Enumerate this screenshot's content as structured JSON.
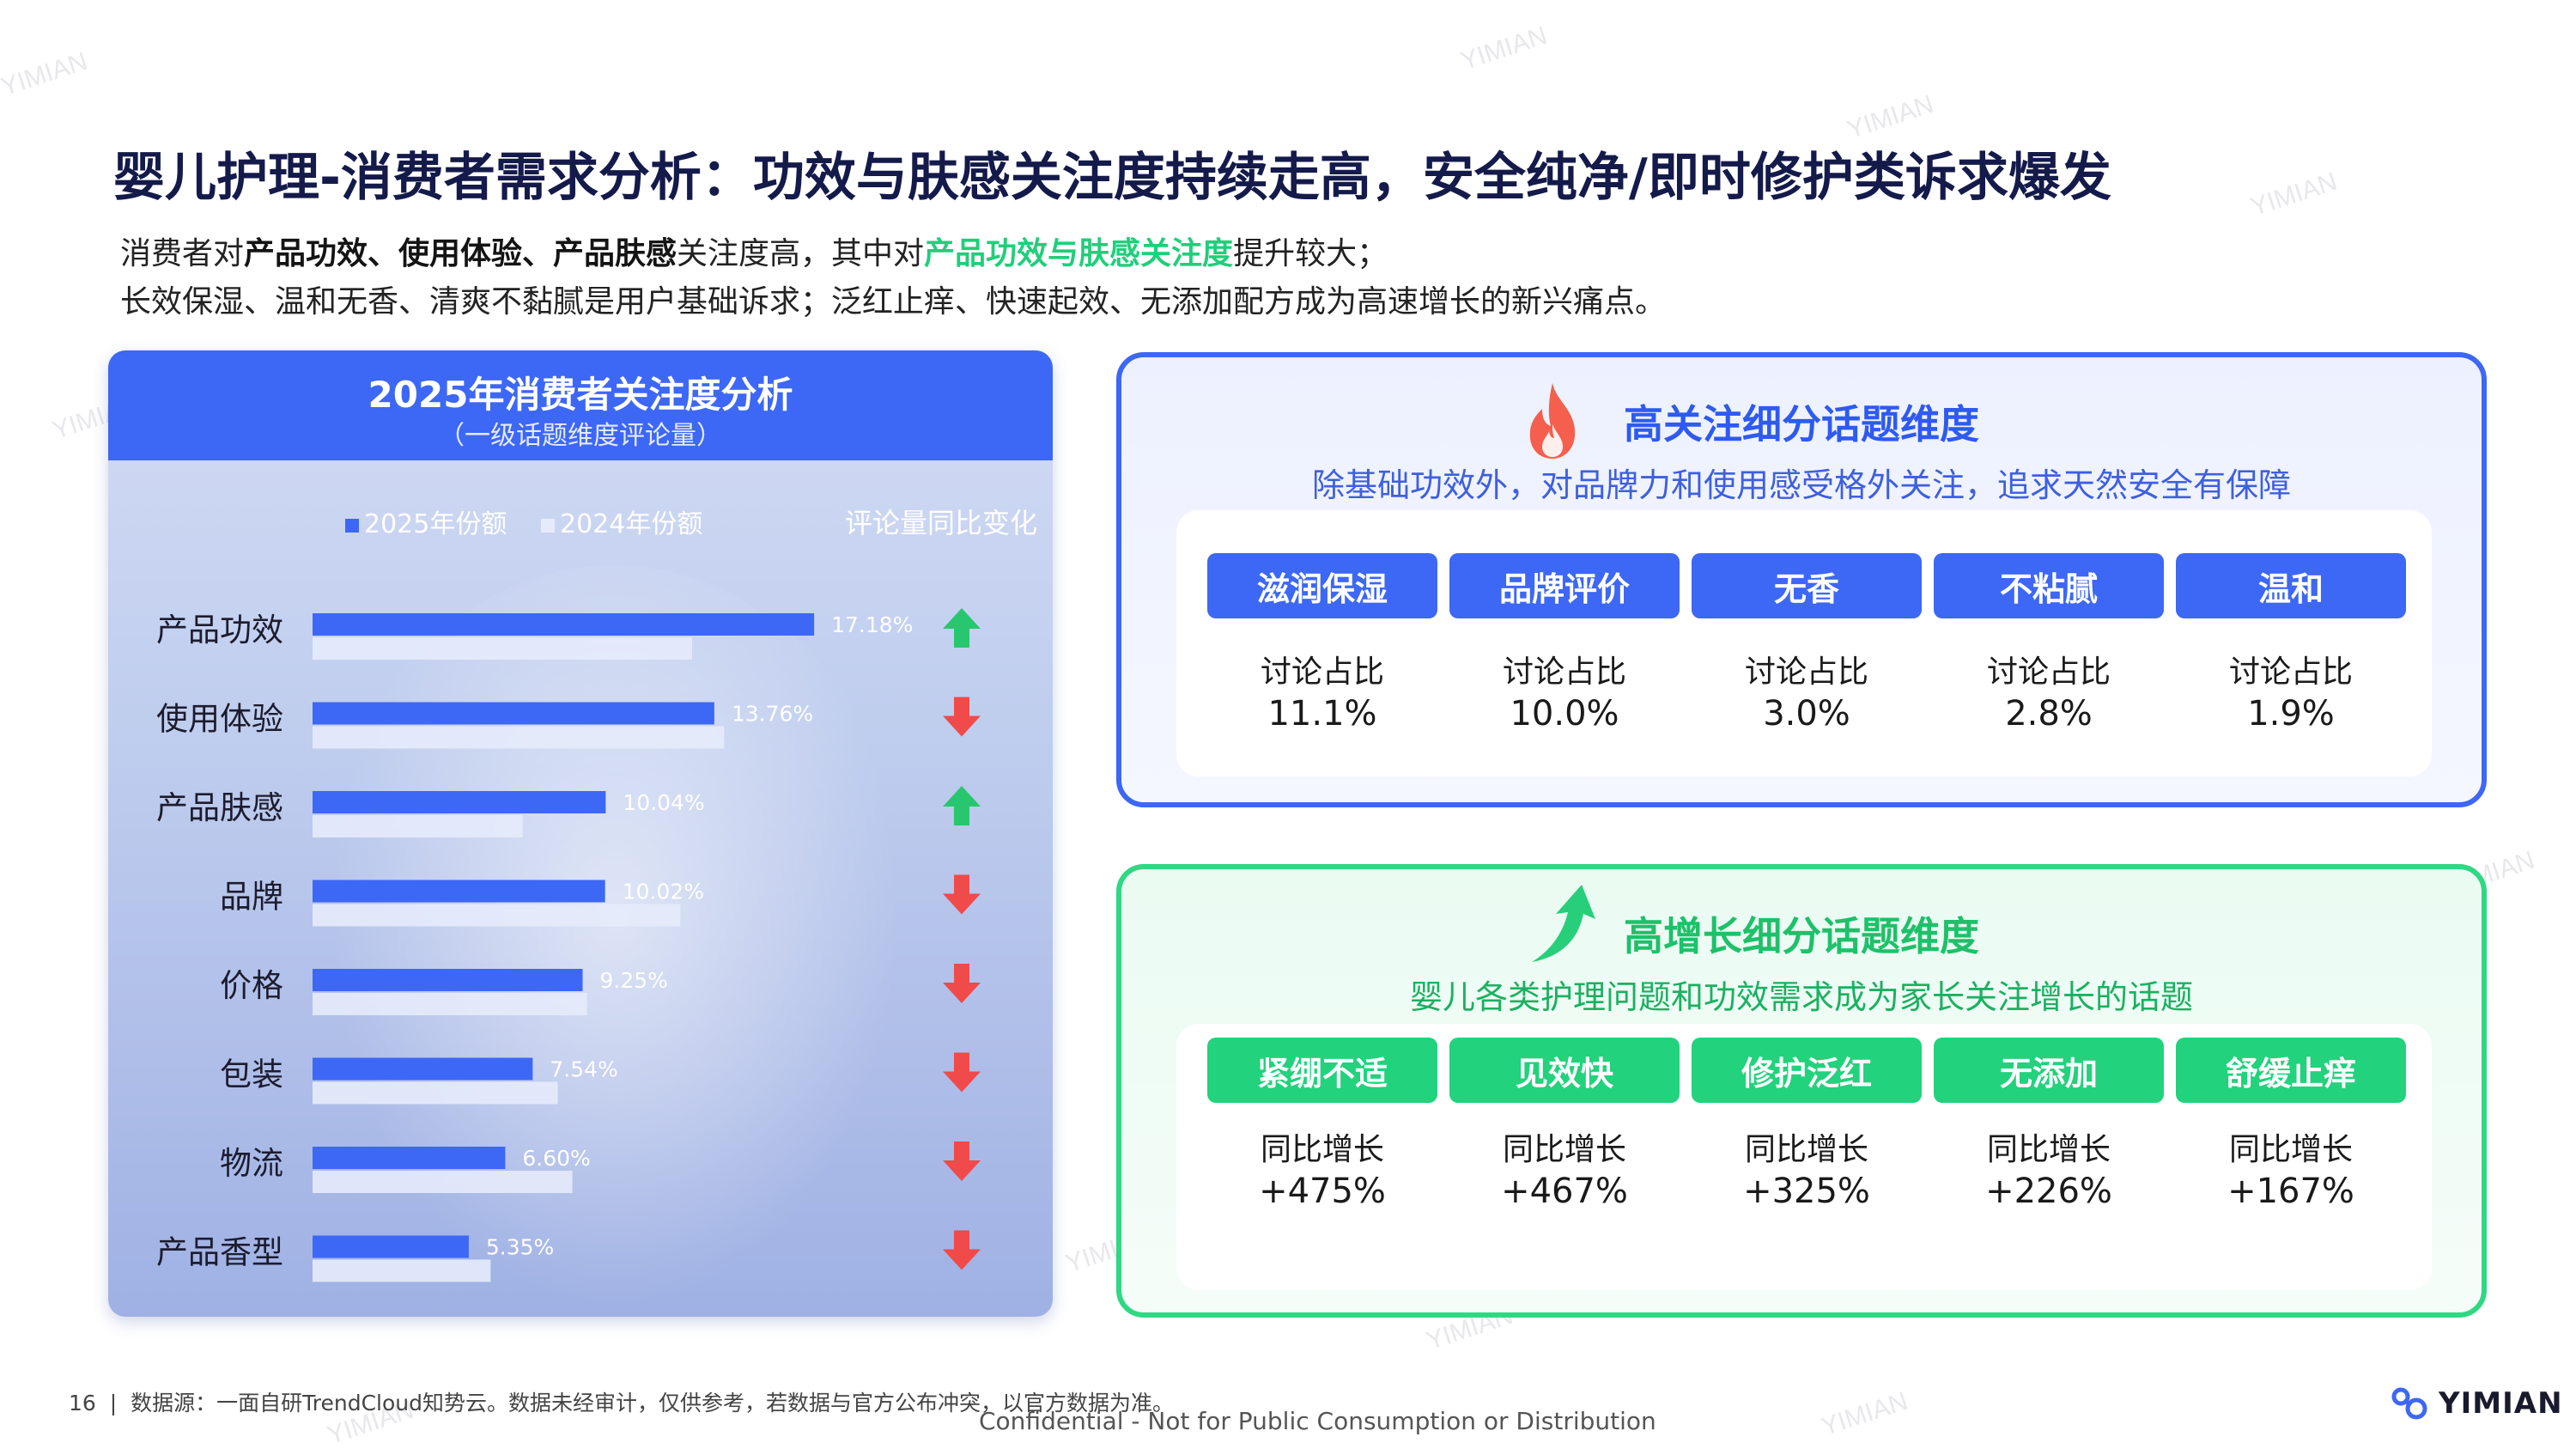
{
  "title": "婴儿护理-消费者需求分析：功效与肤感关注度持续走高，安全纯净/即时修护类诉求爆发",
  "subtitle": {
    "line1_pre": "消费者对",
    "line1_bold": "产品功效、使用体验、产品肤感",
    "line1_mid": "关注度高，其中对",
    "line1_green": "产品功效与肤感关注度",
    "line1_post": "提升较大；",
    "line2": "长效保湿、温和无香、清爽不黏腻是用户基础诉求；泛红止痒、快速起效、无添加配方成为高速增长的新兴痛点。"
  },
  "chart_panel": {
    "title": "2025年消费者关注度分析",
    "subtitle": "（一级话题维度评论量）"
  },
  "chart_data": {
    "type": "bar",
    "orientation": "horizontal",
    "title": "2025年消费者关注度分析",
    "categories": [
      "产品功效",
      "使用体验",
      "产品肤感",
      "品牌",
      "价格",
      "包装",
      "物流",
      "产品香型"
    ],
    "series": [
      {
        "name": "2025年份额",
        "values": [
          17.18,
          13.76,
          10.04,
          10.02,
          9.25,
          7.54,
          6.6,
          5.35
        ],
        "labels": [
          "17.18%",
          "13.76%",
          "10.04%",
          "10.02%",
          "9.25%",
          "7.54%",
          "6.60%",
          "5.35%"
        ]
      },
      {
        "name": "2024年份额",
        "values": [
          13.0,
          14.1,
          7.2,
          12.6,
          9.4,
          8.4,
          8.9,
          6.1
        ]
      }
    ],
    "change_header": "评论量同比变化",
    "change_direction": [
      "up",
      "down",
      "up",
      "down",
      "down",
      "down",
      "down",
      "down"
    ],
    "colors": {
      "y2025": "#3d67f5",
      "y2024": "#e6ebfb",
      "up": "#28c76f",
      "down": "#f04a4a"
    },
    "xlim": [
      0,
      20
    ],
    "grid": false,
    "legend": "top"
  },
  "attention": {
    "heading": "高关注细分话题维度",
    "desc": "除基础功效外，对品牌力和使用感受格外关注，追求天然安全有保障",
    "icon": "flame-icon",
    "tags": [
      "滋润保湿",
      "品牌评价",
      "无香",
      "不粘腻",
      "温和"
    ],
    "metric_label": "讨论占比",
    "values": [
      "11.1%",
      "10.0%",
      "3.0%",
      "2.8%",
      "1.9%"
    ]
  },
  "growth": {
    "heading": "高增长细分话题维度",
    "desc": "婴儿各类护理问题和功效需求成为家长关注增长的话题",
    "icon": "trend-up-arrow-icon",
    "tags": [
      "紧绷不适",
      "见效快",
      "修护泛红",
      "无添加",
      "舒缓止痒"
    ],
    "metric_label": "同比增长",
    "values": [
      "+475%",
      "+467%",
      "+325%",
      "+226%",
      "+167%"
    ]
  },
  "footer": {
    "page_number": "16",
    "separator": "|",
    "source": "数据源：一面自研TrendCloud知势云。数据未经审计，仅供参考，若数据与官方公布冲突，以官方数据为准。",
    "confidential": "Confidential - Not for Public Consumption or Distribution",
    "logo_text": "YIMIAN"
  },
  "watermark_text": "YIMIAN"
}
